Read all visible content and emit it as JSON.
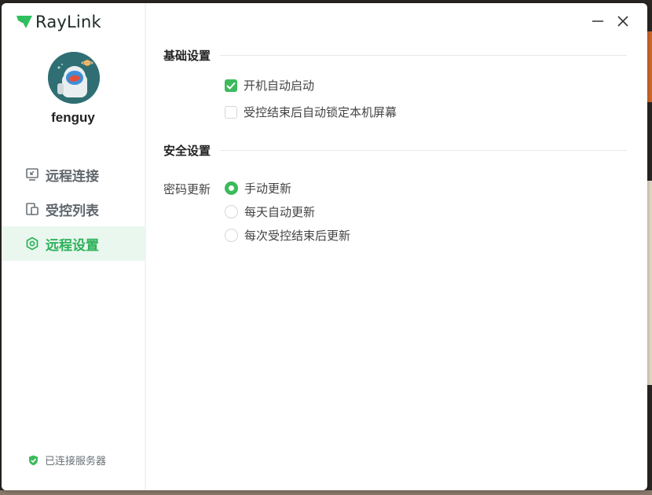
{
  "app": {
    "logo_text": "RayLink"
  },
  "user": {
    "name": "fenguy"
  },
  "sidebar": {
    "items": [
      {
        "label": "远程连接",
        "icon": "remote-connect-icon",
        "active": false
      },
      {
        "label": "受控列表",
        "icon": "controlled-list-icon",
        "active": false
      },
      {
        "label": "远程设置",
        "icon": "settings-hex-icon",
        "active": true
      }
    ],
    "status": "已连接服务器"
  },
  "window_controls": {
    "minimize_icon": "minimize-icon",
    "close_icon": "close-icon"
  },
  "basic": {
    "title": "基础设置",
    "options": [
      {
        "label": "开机自动启动",
        "checked": true
      },
      {
        "label": "受控结束后自动锁定本机屏幕",
        "checked": false
      }
    ]
  },
  "security": {
    "title": "安全设置",
    "password_label": "密码更新",
    "options": [
      {
        "label": "手动更新",
        "selected": true
      },
      {
        "label": "每天自动更新",
        "selected": false
      },
      {
        "label": "每次受控结束后更新",
        "selected": false
      }
    ]
  },
  "colors": {
    "accent": "#3cba5c",
    "active_bg": "#eaf7ef",
    "text": "#444444"
  }
}
